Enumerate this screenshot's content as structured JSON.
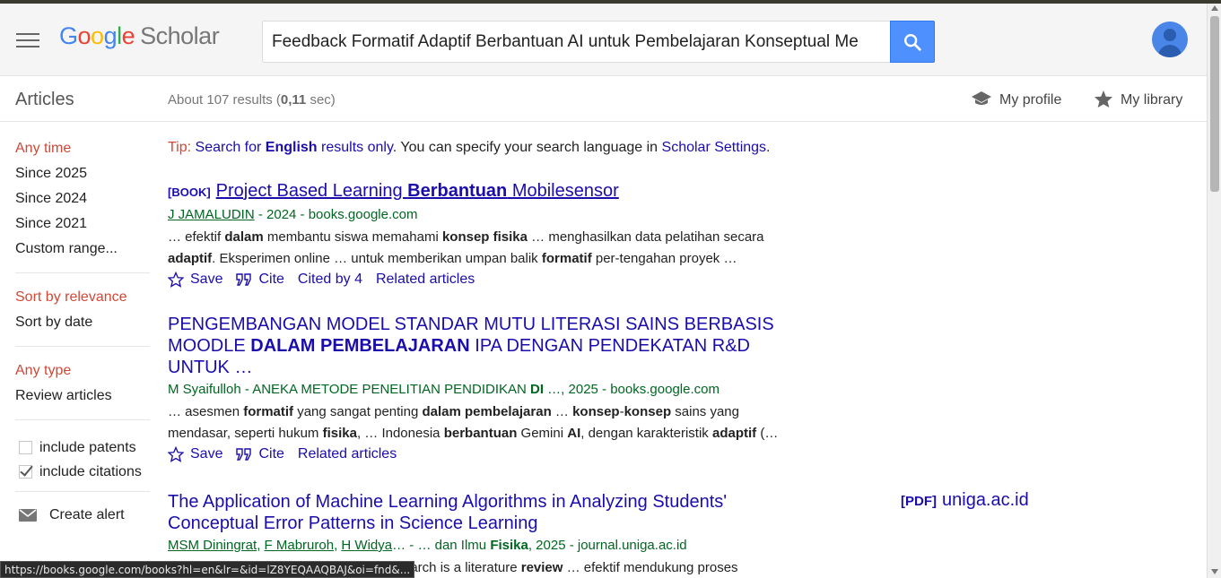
{
  "header": {
    "logo_google": [
      "G",
      "o",
      "o",
      "g",
      "l",
      "e"
    ],
    "logo_scholar": "Scholar",
    "search_value": "Feedback Formatif Adaptif Berbantuan AI untuk Pembelajaran Konseptual Me",
    "icons": {
      "menu": "hamburger-icon",
      "search": "magnifier-icon",
      "account": "avatar-icon"
    }
  },
  "subheader": {
    "articles": "Articles",
    "stats_prefix": "About 107 results (",
    "stats_time": "0,11",
    "stats_suffix": " sec)",
    "my_profile": "My profile",
    "my_library": "My library"
  },
  "sidebar": {
    "time_filters": [
      "Any time",
      "Since 2025",
      "Since 2024",
      "Since 2021",
      "Custom range..."
    ],
    "sort_options": [
      "Sort by relevance",
      "Sort by date"
    ],
    "type_filters": [
      "Any type",
      "Review articles"
    ],
    "include_patents": "include patents",
    "include_citations": "include citations",
    "create_alert": "Create alert"
  },
  "tip": {
    "label": "Tip:",
    "link1_a": "Search for ",
    "link1_b": "English",
    "link1_c": " results only",
    "middle": ". You can specify your search language in ",
    "settings_link": "Scholar Settings",
    "end": "."
  },
  "results": [
    {
      "tag": "[BOOK]",
      "title_a": "Project Based Learning ",
      "title_b": "Berbantuan",
      "title_c": " Mobilesensor",
      "meta_author": "J JAMALUDIN",
      "meta_rest": " - 2024 - books.google.com",
      "snippet1": [
        "… efektif ",
        "dalam",
        " membantu siswa memahami ",
        "konsep fisika",
        " … menghasilkan data pelatihan secara"
      ],
      "snippet2": [
        "adaptif",
        ". Eksperimen online … untuk memberikan umpan balik ",
        "formatif",
        " per-tengahan proyek …"
      ],
      "save": "Save",
      "cite": "Cite",
      "cited_by": "Cited by 4",
      "related": "Related articles"
    },
    {
      "title_line1": "PENGEMBANGAN MODEL STANDAR MUTU LITERASI SAINS BERBASIS",
      "title_line2_a": "MOODLE ",
      "title_line2_b": "DALAM PEMBELAJARAN",
      "title_line2_c": " IPA DENGAN PENDEKATAN R&D",
      "title_line3": "UNTUK …",
      "meta_a": "M Syaifulloh - ANEKA METODE PENELITIAN PENDIDIKAN ",
      "meta_b": "DI",
      "meta_c": " …, 2025 - books.google.com",
      "snippet1": [
        "… asesmen ",
        "formatif",
        " yang sangat penting ",
        "dalam pembelajaran",
        " … ",
        "konsep",
        "-",
        "konsep",
        " sains yang"
      ],
      "snippet2": [
        "mendasar, seperti hukum ",
        "fisika",
        ", … Indonesia ",
        "berbantuan",
        " Gemini ",
        "AI",
        ", dengan karakteristik ",
        "adaptif",
        " (…"
      ],
      "save": "Save",
      "cite": "Cite",
      "related": "Related articles"
    },
    {
      "title_line1": "The Application of Machine Learning Algorithms in Analyzing Students'",
      "title_line2": "Conceptual Error Patterns in Science Learning",
      "authors": [
        "MSM Diningrat",
        "F Mabruroh",
        "H Widya"
      ],
      "meta_a": "… - … dan Ilmu ",
      "meta_b": "Fisika",
      "meta_c": ", 2025 - journal.uniga.ac.id",
      "snippet1": [
        "earch is a literature ",
        "review",
        " … efektif mendukung proses"
      ],
      "pdf_tag": "[PDF]",
      "pdf_source": "uniga.ac.id"
    }
  ],
  "status_bar_url": "https://books.google.com/books?hl=en&lr=&id=lZ8YEQAAQBAJ&oi=fnd&..."
}
